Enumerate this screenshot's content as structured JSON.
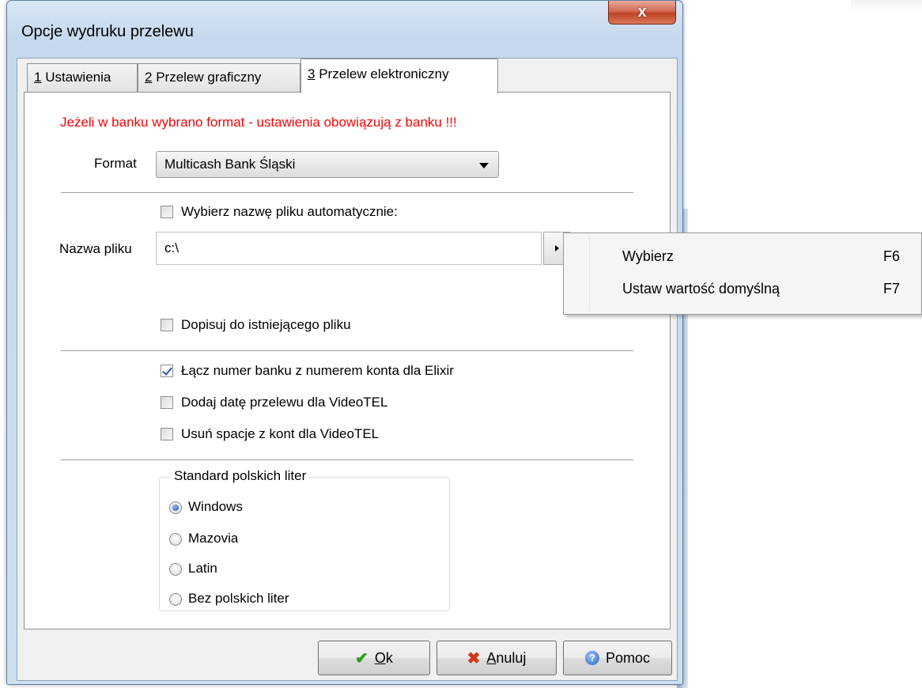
{
  "window": {
    "title": "Opcje wydruku przelewu",
    "close_label": "x"
  },
  "tabs": [
    {
      "key": "1",
      "label": " Ustawienia",
      "active": false
    },
    {
      "key": "2",
      "label": " Przelew graficzny",
      "active": false
    },
    {
      "key": "3",
      "label": " Przelew elektroniczny",
      "active": true
    }
  ],
  "panel": {
    "warning": "Jeżeli w banku wybrano format - ustawienia obowiązują z banku !!!",
    "format_label": "Format",
    "format_value": "Multicash Bank Śląski",
    "auto_filename": {
      "label": "Wybierz nazwę pliku automatycznie:",
      "checked": false
    },
    "filename_label": "Nazwa pliku",
    "filename_value": "c:\\",
    "append": {
      "label": "Dopisuj do istniejącego pliku",
      "checked": false
    },
    "options": [
      {
        "label": "Łącz numer banku z numerem konta dla Elixir",
        "checked": true
      },
      {
        "label": "Dodaj datę przelewu dla VideoTEL",
        "checked": false
      },
      {
        "label": "Usuń spacje z kont dla VideoTEL",
        "checked": false
      }
    ],
    "charset": {
      "title": "Standard polskich liter",
      "options": [
        {
          "label": "Windows",
          "selected": true
        },
        {
          "label": "Mazovia",
          "selected": false
        },
        {
          "label": "Latin",
          "selected": false
        },
        {
          "label": "Bez polskich liter",
          "selected": false
        }
      ]
    }
  },
  "buttons": {
    "ok": {
      "key": "O",
      "rest": "k"
    },
    "cancel": {
      "key": "A",
      "rest": "nuluj"
    },
    "help": {
      "label": "Pomoc"
    }
  },
  "menu": {
    "items": [
      {
        "label": "Wybierz",
        "shortcut": "F6"
      },
      {
        "label": "Ustaw wartość domyślną",
        "shortcut": "F7"
      }
    ]
  },
  "colors": {
    "warning": "#ff0000",
    "check": "#2b5aa8",
    "close": "#c04324"
  }
}
